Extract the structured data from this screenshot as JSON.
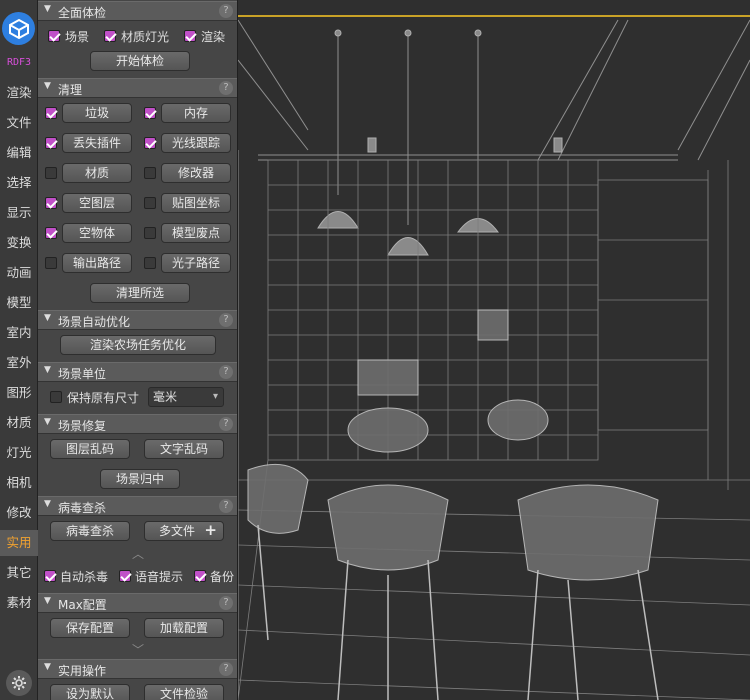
{
  "leftbar": {
    "badge": "RDF3",
    "items": [
      {
        "label": "渲染"
      },
      {
        "label": "文件"
      },
      {
        "label": "编辑"
      },
      {
        "label": "选择"
      },
      {
        "label": "显示"
      },
      {
        "label": "变换"
      },
      {
        "label": "动画"
      },
      {
        "label": "模型"
      },
      {
        "label": "室内"
      },
      {
        "label": "室外"
      },
      {
        "label": "图形"
      },
      {
        "label": "材质"
      },
      {
        "label": "灯光"
      },
      {
        "label": "相机"
      },
      {
        "label": "修改"
      },
      {
        "label": "实用"
      },
      {
        "label": "其它"
      },
      {
        "label": "素材"
      }
    ],
    "active_item": "实用",
    "accent_color": "#f1a230",
    "brand_color": "#2e7fe0",
    "settings_icon": "gear-icon"
  },
  "sections": {
    "full_check": {
      "title": "全面体检",
      "scene": "场景",
      "material_light": "材质灯光",
      "render": "渲染",
      "start": "开始体检"
    },
    "cleanup": {
      "title": "清理",
      "garbage": "垃圾",
      "memory": "内存",
      "missing_plugins": "丢失插件",
      "raytrace": "光线跟踪",
      "material": "材质",
      "modifier": "修改器",
      "empty_layer": "空图层",
      "map_coords": "贴图坐标",
      "empty_object": "空物体",
      "model_waste": "模型废点",
      "output_path": "输出路径",
      "photon_path": "光子路径",
      "clean_selected": "清理所选"
    },
    "auto_opt": {
      "title": "场景自动优化",
      "farm_opt": "渲染农场任务优化"
    },
    "units": {
      "title": "场景单位",
      "keep_size": "保持原有尺寸",
      "unit_value": "毫米"
    },
    "repair": {
      "title": "场景修复",
      "layer_garbled": "图层乱码",
      "text_garbled": "文字乱码",
      "scene_center": "场景归中"
    },
    "antivirus": {
      "title": "病毒查杀",
      "scan": "病毒查杀",
      "multi_file": "多文件",
      "plus": "+",
      "auto_kill": "自动杀毒",
      "voice_tip": "语音提示",
      "backup": "备份"
    },
    "max_config": {
      "title": "Max配置",
      "save": "保存配置",
      "load": "加载配置"
    },
    "utility": {
      "title": "实用操作",
      "set_default": "设为默认",
      "file_check": "文件检验"
    }
  },
  "checkbox_color": "#c050c8",
  "help_glyph": "?",
  "collapse_glyph": "▼",
  "chev_up": "︿",
  "chev_down": "﹀",
  "select_caret": "▾"
}
